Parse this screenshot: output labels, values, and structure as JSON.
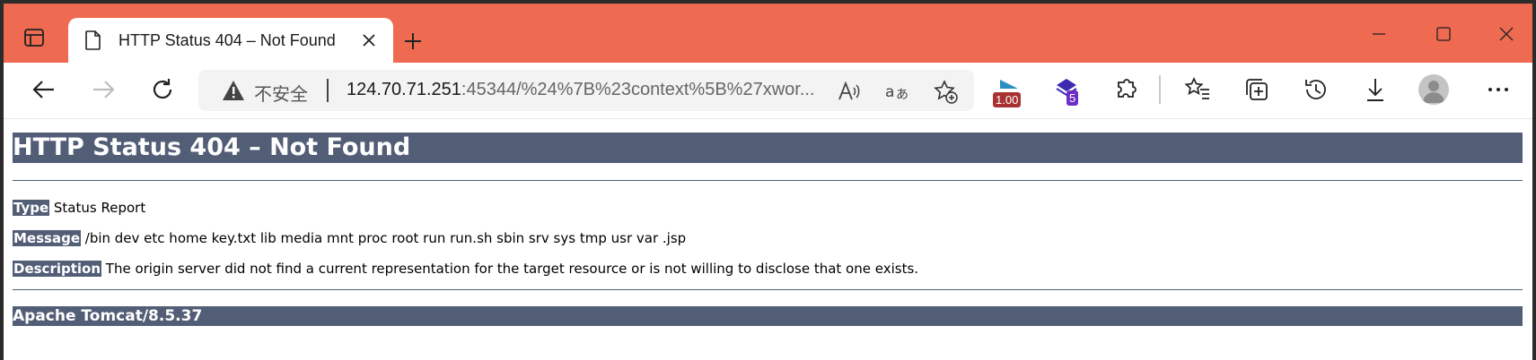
{
  "browser": {
    "tab": {
      "title": "HTTP Status 404 – Not Found"
    },
    "address_bar": {
      "security_label": "不安全",
      "url_host": "124.70.71.251",
      "url_rest": ":45344/%24%7B%23context%5B%27xwor..."
    },
    "extensions": [
      {
        "name": "zoom-extension",
        "badge": "1.00",
        "badge_color": "#a83232"
      },
      {
        "name": "stacks-extension",
        "badge": "5",
        "badge_color": "#6b2fc4"
      }
    ],
    "colors": {
      "titlebar": "#ee6a51",
      "accent": "#525d76"
    }
  },
  "page": {
    "heading": "HTTP Status 404 – Not Found",
    "type_label": "Type",
    "type_value": " Status Report",
    "message_label": "Message",
    "message_value": " /bin dev etc home key.txt lib media mnt proc root run run.sh sbin srv sys tmp usr var .jsp",
    "description_label": "Description",
    "description_value": " The origin server did not find a current representation for the target resource or is not willing to disclose that one exists.",
    "footer": "Apache Tomcat/8.5.37"
  }
}
